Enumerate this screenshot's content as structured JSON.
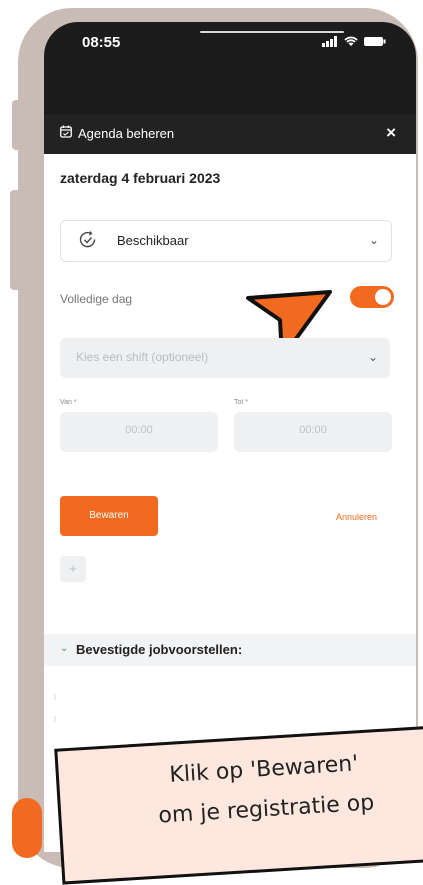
{
  "status_bar": {
    "time": "08:55"
  },
  "modal": {
    "title": "Agenda beheren",
    "date": "zaterdag 4 februari 2023",
    "status_select": {
      "selected": "Beschikbaar"
    },
    "full_day": {
      "label": "Volledige dag",
      "enabled": true
    },
    "shift_select": {
      "placeholder": "Kies een shift (optioneel)"
    },
    "from": {
      "label": "Van *",
      "value": "00:00"
    },
    "to": {
      "label": "Tot *",
      "value": "00:00"
    },
    "save_label": "Bewaren",
    "cancel_label": "Annuleren",
    "add_label": "+",
    "confirmed_section": "Bevestigde jobvoorstellen:"
  },
  "note": {
    "line1": "Klik op 'Bewaren'",
    "line2": "om je registratie op"
  },
  "colors": {
    "accent": "#f26a1f",
    "header_bg": "#1c1c1c",
    "frame": "#c9bcb6"
  }
}
